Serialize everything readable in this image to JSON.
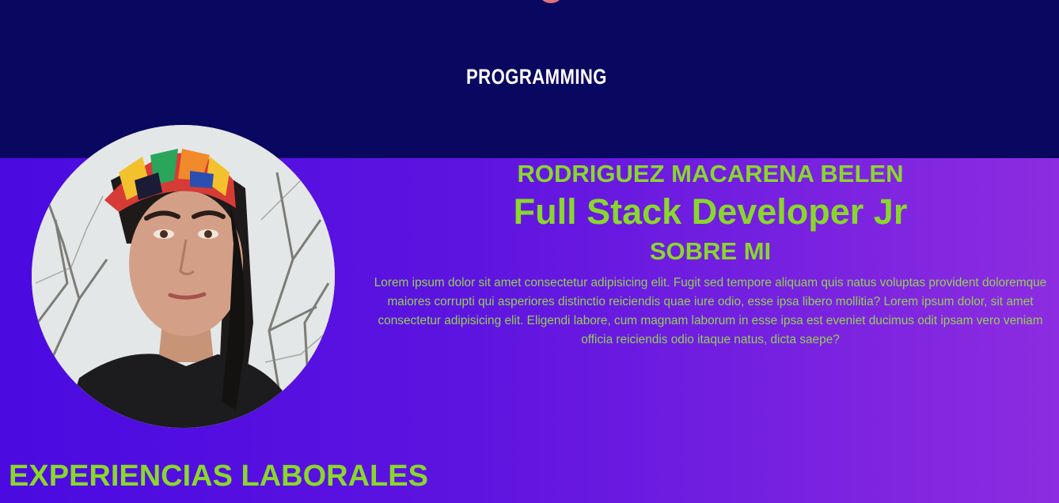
{
  "header": {
    "brand": "PROGRAMMING"
  },
  "profile": {
    "name": "RODRIGUEZ MACARENA BELEN",
    "role": "Full Stack Developer Jr",
    "about_title": "SOBRE MI",
    "about_text": "Lorem ipsum dolor sit amet consectetur adipisicing elit. Fugit sed tempore aliquam quis natus voluptas provident doloremque maiores corrupti qui asperiores distinctio reiciendis quae iure odio, esse ipsa libero mollitia? Lorem ipsum dolor, sit amet consectetur adipisicing elit. Eligendi labore, cum magnam laborum in esse ipsa est eveniet ducimus odit ipsam vero veniam officia reiciendis odio itaque natus, dicta saepe?",
    "photo_icon": "profile-photo"
  },
  "sections": {
    "experience_title": "EXPERIENCIAS LABORALES"
  },
  "colors": {
    "header_bg": "#0a0760",
    "accent_green": "#8ad72c",
    "gradient_start": "#4a0ae0",
    "gradient_end": "#8d2ce0",
    "brand_text": "#ffffff"
  }
}
